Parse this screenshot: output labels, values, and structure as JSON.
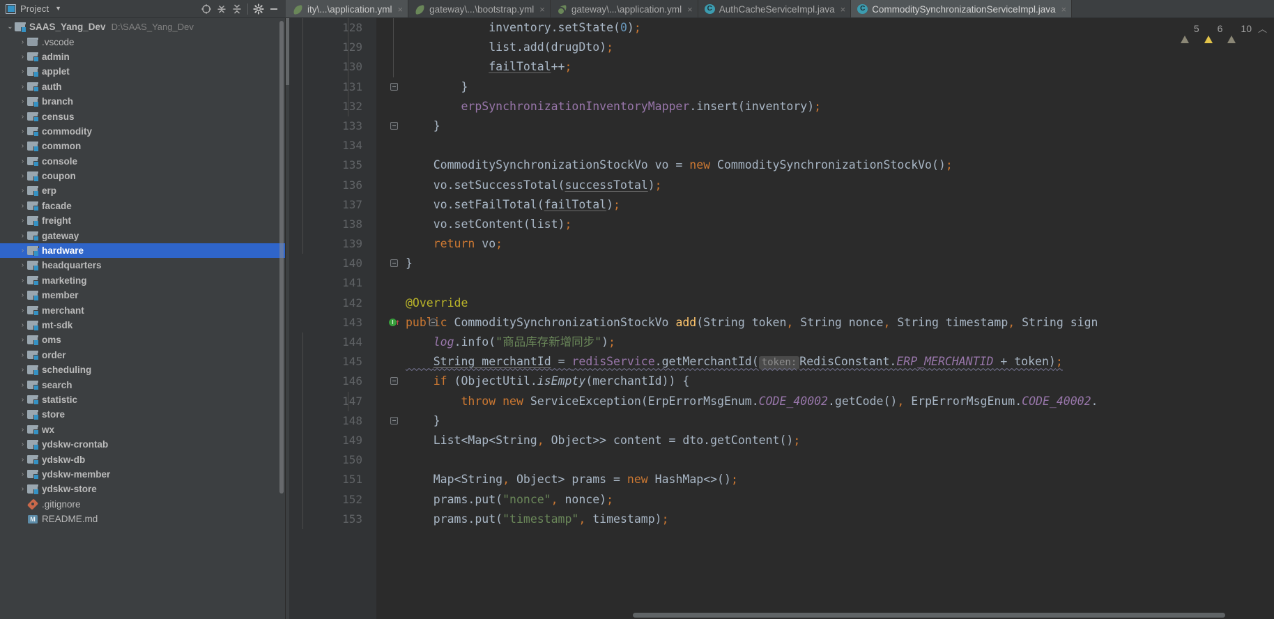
{
  "project_panel": {
    "title": "Project",
    "icon": "project-window-icon",
    "dropdown_icon": "chevron-down-icon",
    "toolbar": [
      {
        "name": "select-opened-file-icon",
        "label": "⊕"
      },
      {
        "name": "expand-all-icon",
        "label": "⇕"
      },
      {
        "name": "collapse-all-icon",
        "label": "⇳"
      },
      {
        "name": "settings-gear-icon",
        "label": "gear"
      },
      {
        "name": "hide-icon",
        "label": "—"
      }
    ],
    "root": {
      "label": "SAAS_Yang_Dev",
      "path": "D:\\SAAS_Yang_Dev",
      "expanded": true
    },
    "items": [
      {
        "label": ".vscode",
        "icon": "folder-icon",
        "bold": false,
        "selected": false
      },
      {
        "label": "admin",
        "icon": "module-folder-icon",
        "bold": true,
        "selected": false
      },
      {
        "label": "applet",
        "icon": "module-folder-icon",
        "bold": true,
        "selected": false
      },
      {
        "label": "auth",
        "icon": "module-folder-icon",
        "bold": true,
        "selected": false
      },
      {
        "label": "branch",
        "icon": "module-folder-icon",
        "bold": true,
        "selected": false
      },
      {
        "label": "census",
        "icon": "module-folder-icon",
        "bold": true,
        "selected": false
      },
      {
        "label": "commodity",
        "icon": "module-folder-icon",
        "bold": true,
        "selected": false
      },
      {
        "label": "common",
        "icon": "module-folder-icon",
        "bold": true,
        "selected": false
      },
      {
        "label": "console",
        "icon": "module-folder-icon",
        "bold": true,
        "selected": false
      },
      {
        "label": "coupon",
        "icon": "module-folder-icon",
        "bold": true,
        "selected": false
      },
      {
        "label": "erp",
        "icon": "module-folder-icon",
        "bold": true,
        "selected": false
      },
      {
        "label": "facade",
        "icon": "module-folder-icon",
        "bold": true,
        "selected": false
      },
      {
        "label": "freight",
        "icon": "module-folder-icon",
        "bold": true,
        "selected": false
      },
      {
        "label": "gateway",
        "icon": "module-folder-icon",
        "bold": true,
        "selected": false
      },
      {
        "label": "hardware",
        "icon": "module-folder-icon",
        "bold": true,
        "selected": true
      },
      {
        "label": "headquarters",
        "icon": "module-folder-icon",
        "bold": true,
        "selected": false
      },
      {
        "label": "marketing",
        "icon": "module-folder-icon",
        "bold": true,
        "selected": false
      },
      {
        "label": "member",
        "icon": "module-folder-icon",
        "bold": true,
        "selected": false
      },
      {
        "label": "merchant",
        "icon": "module-folder-icon",
        "bold": true,
        "selected": false
      },
      {
        "label": "mt-sdk",
        "icon": "module-folder-icon",
        "bold": true,
        "selected": false
      },
      {
        "label": "oms",
        "icon": "module-folder-icon",
        "bold": true,
        "selected": false
      },
      {
        "label": "order",
        "icon": "module-folder-icon",
        "bold": true,
        "selected": false
      },
      {
        "label": "scheduling",
        "icon": "module-folder-icon",
        "bold": true,
        "selected": false
      },
      {
        "label": "search",
        "icon": "module-folder-icon",
        "bold": true,
        "selected": false
      },
      {
        "label": "statistic",
        "icon": "module-folder-icon",
        "bold": true,
        "selected": false
      },
      {
        "label": "store",
        "icon": "module-folder-icon",
        "bold": true,
        "selected": false
      },
      {
        "label": "wx",
        "icon": "module-folder-icon",
        "bold": true,
        "selected": false
      },
      {
        "label": "ydskw-crontab",
        "icon": "module-folder-icon",
        "bold": true,
        "selected": false
      },
      {
        "label": "ydskw-db",
        "icon": "module-folder-icon",
        "bold": true,
        "selected": false
      },
      {
        "label": "ydskw-member",
        "icon": "module-folder-icon",
        "bold": true,
        "selected": false
      },
      {
        "label": "ydskw-store",
        "icon": "module-folder-icon",
        "bold": true,
        "selected": false
      },
      {
        "label": ".gitignore",
        "icon": "gitignore-file-icon",
        "bold": false,
        "selected": false
      },
      {
        "label": "README.md",
        "icon": "markdown-file-icon",
        "bold": false,
        "selected": false
      }
    ]
  },
  "tabs": [
    {
      "label": "ity\\...\\application.yml",
      "icon": "yaml-file-icon",
      "active": true,
      "selected": false,
      "close": "×"
    },
    {
      "label": "gateway\\...\\bootstrap.yml",
      "icon": "yaml-file-icon",
      "active": false,
      "selected": false,
      "close": "×"
    },
    {
      "label": "gateway\\...\\application.yml",
      "icon": "yaml-gear-icon",
      "active": false,
      "selected": false,
      "close": "×"
    },
    {
      "label": "AuthCacheServiceImpl.java",
      "icon": "java-class-icon",
      "active": false,
      "selected": false,
      "close": "×"
    },
    {
      "label": "CommoditySynchronizationServiceImpl.java",
      "icon": "java-class-icon",
      "active": false,
      "selected": true,
      "close": "×"
    }
  ],
  "inspection_widget": {
    "grey_warning_count": "5",
    "yellow_warning_count": "6",
    "weak_warning_count": "10",
    "collapse_icon": "chevron-up-icon"
  },
  "editor": {
    "first_line_number": 128,
    "lines": [
      {
        "n": "128",
        "marker": null,
        "fold": null
      },
      {
        "n": "129",
        "marker": null,
        "fold": null
      },
      {
        "n": "130",
        "marker": null,
        "fold": null
      },
      {
        "n": "131",
        "marker": null,
        "fold": "end"
      },
      {
        "n": "132",
        "marker": null,
        "fold": null
      },
      {
        "n": "133",
        "marker": null,
        "fold": "end"
      },
      {
        "n": "134",
        "marker": null,
        "fold": null
      },
      {
        "n": "135",
        "marker": null,
        "fold": null
      },
      {
        "n": "136",
        "marker": null,
        "fold": null
      },
      {
        "n": "137",
        "marker": null,
        "fold": null
      },
      {
        "n": "138",
        "marker": null,
        "fold": null
      },
      {
        "n": "139",
        "marker": null,
        "fold": null
      },
      {
        "n": "140",
        "marker": null,
        "fold": "end"
      },
      {
        "n": "141",
        "marker": null,
        "fold": null
      },
      {
        "n": "142",
        "marker": null,
        "fold": null
      },
      {
        "n": "143",
        "marker": "implements-method-icon",
        "fold": "start"
      },
      {
        "n": "144",
        "marker": null,
        "fold": null
      },
      {
        "n": "145",
        "marker": null,
        "fold": null
      },
      {
        "n": "146",
        "marker": null,
        "fold": "start"
      },
      {
        "n": "147",
        "marker": null,
        "fold": null
      },
      {
        "n": "148",
        "marker": null,
        "fold": "end"
      },
      {
        "n": "149",
        "marker": null,
        "fold": null
      },
      {
        "n": "150",
        "marker": null,
        "fold": null
      },
      {
        "n": "151",
        "marker": null,
        "fold": null
      },
      {
        "n": "152",
        "marker": null,
        "fold": null
      },
      {
        "n": "153",
        "marker": null,
        "fold": null
      }
    ],
    "source_text": [
      "            inventory.setState(0);",
      "            list.add(drugDto);",
      "            failTotal++;",
      "        }",
      "        erpSynchronizationInventoryMapper.insert(inventory);",
      "    }",
      "",
      "    CommoditySynchronizationStockVo vo = new CommoditySynchronizationStockVo();",
      "    vo.setSuccessTotal(successTotal);",
      "    vo.setFailTotal(failTotal);",
      "    vo.setContent(list);",
      "    return vo;",
      "}",
      "",
      "@Override",
      "public CommoditySynchronizationStockVo add(String token, String nonce, String timestamp, String sign",
      "    log.info(\"商品库存新增同步\");",
      "    String merchantId = redisService.getMerchantId( token: RedisConstant.ERP_MERCHANTID + token);",
      "    if (ObjectUtil.isEmpty(merchantId)) {",
      "        throw new ServiceException(ErpErrorMsgEnum.CODE_40002.getCode(), ErpErrorMsgEnum.CODE_40002.",
      "    }",
      "    List<Map<String, Object>> content = dto.getContent();",
      "",
      "    Map<String, Object> prams = new HashMap<>();",
      "    prams.put(\"nonce\", nonce);",
      "    prams.put(\"timestamp\", timestamp);"
    ],
    "inline_hints": [
      {
        "line": "145",
        "text": "token:"
      }
    ],
    "horizontal_scrollbar": true
  },
  "colors": {
    "editor_bg": "#2b2b2b",
    "panel_bg": "#3c3f41",
    "gutter_bg": "#313335",
    "selection_blue": "#2f65ca",
    "keyword_orange": "#cc7832",
    "string_green": "#6a8759",
    "field_purple": "#9876aa",
    "number_blue": "#6897bb",
    "annotation_yellow": "#bbb529",
    "method_yellow": "#ffc66d",
    "default_text": "#a9b7c6",
    "accent_teal": "#3c9cb0"
  }
}
